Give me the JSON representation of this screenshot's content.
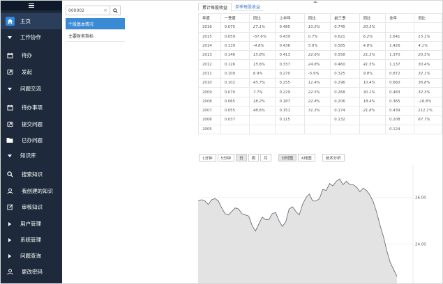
{
  "sidebar": {
    "items": [
      {
        "label": "主页",
        "icon": "home-icon",
        "kind": "home"
      },
      {
        "label": "工作协作",
        "icon": "triangle-down-icon",
        "kind": "section"
      },
      {
        "label": "待办",
        "icon": "calendar-icon",
        "kind": "sub"
      },
      {
        "label": "发起",
        "icon": "send-icon",
        "kind": "sub"
      },
      {
        "label": "问题交流",
        "icon": "triangle-down-icon",
        "kind": "section"
      },
      {
        "label": "待办事项",
        "icon": "calendar-icon",
        "kind": "sub"
      },
      {
        "label": "提交问题",
        "icon": "send-icon",
        "kind": "sub"
      },
      {
        "label": "已办问题",
        "icon": "folder-icon",
        "kind": "sub"
      },
      {
        "label": "知识库",
        "icon": "triangle-down-icon",
        "kind": "section"
      },
      {
        "label": "搜索知识",
        "icon": "search-icon",
        "kind": "sub"
      },
      {
        "label": "我创建的知识",
        "icon": "user-icon",
        "kind": "sub"
      },
      {
        "label": "审核知识",
        "icon": "edit-icon",
        "kind": "sub"
      },
      {
        "label": "用户管理",
        "icon": "triangle-right-icon",
        "kind": "section"
      },
      {
        "label": "系统管理",
        "icon": "triangle-right-icon",
        "kind": "section"
      },
      {
        "label": "问题查询",
        "icon": "triangle-right-icon",
        "kind": "section"
      },
      {
        "label": "更改密码",
        "icon": "user-icon",
        "kind": "sub"
      }
    ]
  },
  "search": {
    "value": "000002",
    "clear": "×"
  },
  "stock_menu": [
    "个股基本情况",
    "主要财务指标"
  ],
  "tabs": [
    "累计每股收益",
    "单季每股收益"
  ],
  "table": {
    "headers": [
      "年度",
      "一季度",
      "同比",
      "上半年",
      "同比",
      "前三季",
      "同比",
      "全年",
      "同比"
    ],
    "rows": [
      [
        "2016",
        "0.075",
        "27.1%",
        "0.485",
        "10.5%",
        "0.745",
        "20.5%",
        "",
        ""
      ],
      [
        "2015",
        "0.059",
        "-57.6%",
        "0.439",
        "0.7%",
        "0.621",
        "6.2%",
        "1.641",
        "15.1%"
      ],
      [
        "2014",
        "0.139",
        "-4.8%",
        "0.436",
        "5.8%",
        "0.585",
        "4.8%",
        "1.426",
        "4.1%"
      ],
      [
        "2013",
        "0.146",
        "15.8%",
        "0.413",
        "22.6%",
        "0.558",
        "21.3%",
        "1.370",
        "20.5%"
      ],
      [
        "2012",
        "0.126",
        "15.6%",
        "0.337",
        "24.8%",
        "0.460",
        "41.5%",
        "1.137",
        "30.4%"
      ],
      [
        "2011",
        "0.109",
        "6.9%",
        "0.270",
        "-5.9%",
        "0.325",
        "9.8%",
        "0.872",
        "32.1%"
      ],
      [
        "2010",
        "0.102",
        "45.7%",
        "0.255",
        "11.4%",
        "0.296",
        "10.4%",
        "0.660",
        "36.8%"
      ],
      [
        "2009",
        "0.070",
        "7.7%",
        "0.229",
        "22.5%",
        "0.268",
        "30.1%",
        "0.483",
        "32.3%"
      ],
      [
        "2008",
        "0.065",
        "18.2%",
        "0.187",
        "22.8%",
        "0.206",
        "18.4%",
        "0.365",
        "-16.8%"
      ],
      [
        "2007",
        "0.055",
        "48.6%",
        "0.151",
        "31.3%",
        "0.174",
        "21.8%",
        "0.439",
        "111.1%"
      ],
      [
        "2006",
        "0.037",
        "",
        "0.115",
        "",
        "0.132",
        "",
        "0.208",
        "67.7%"
      ],
      [
        "2005",
        "",
        "",
        "",
        "",
        "",
        "",
        "0.124",
        ""
      ]
    ]
  },
  "chart_controls": {
    "periods": [
      "1分钟",
      "5分钟",
      "日",
      "周",
      "月"
    ],
    "selected_period": "日",
    "views": [
      "分时图",
      "K线图"
    ],
    "selected_view": "分时图",
    "analysis": "技术分析"
  },
  "chart_data": {
    "type": "area",
    "y_ticks": [
      "26.00",
      "24.00"
    ],
    "ylim": [
      22.3,
      27.4
    ],
    "values": [
      25.85,
      25.9,
      25.85,
      25.7,
      25.9,
      25.95,
      25.85,
      25.55,
      25.3,
      25.25,
      25.4,
      25.55,
      25.5,
      25.3,
      25.25,
      25.2,
      24.8,
      24.55,
      24.85,
      25.15,
      25.05,
      25.05,
      25.3,
      25.35,
      25.0,
      24.75,
      24.95,
      25.5,
      25.6,
      25.4,
      25.25,
      25.7,
      26.0,
      26.15,
      25.85,
      25.85,
      25.95,
      26.35,
      26.3,
      26.6,
      26.5,
      26.7,
      26.8,
      26.55,
      26.7,
      26.55,
      26.55,
      26.45,
      26.25,
      26.4,
      26.3,
      26.1,
      25.8,
      25.35,
      24.8,
      24.3,
      23.7,
      23.2,
      22.9,
      22.6
    ]
  },
  "colors": {
    "sidebar": "#1e2a3b",
    "accent": "#3b8ad6",
    "up": "#c0504d",
    "down": "#4aa04a"
  }
}
